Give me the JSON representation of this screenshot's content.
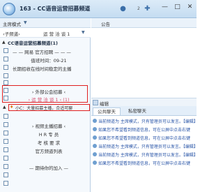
{
  "window": {
    "title": "163 - CC语音运营招募频道",
    "count": "2",
    "controls": {
      "minimize": "—",
      "maximize": "□",
      "close": "✕"
    }
  },
  "left": {
    "mode_label": "主席模式",
    "mode_arrow": "▼",
    "search_left": "‹子频道›",
    "search_right": "运 营 洽 谈 1",
    "search_arrow": "▼",
    "channel_arrow": "▲",
    "channel_name": "CC语音运营招募频道(1)",
    "rows": [
      {
        "text": "— — 网易 官方招聘 — — —",
        "center": false
      },
      {
        "text": "值班时间：09-21",
        "center": false
      },
      {
        "text": "长期招收在线时间稳定的主播",
        "center": false
      },
      {
        "text": "",
        "center": false
      },
      {
        "text": "",
        "center": false
      },
      {
        "text": "",
        "center": false
      },
      {
        "text": "› 外部公会招募 ‹",
        "center": true
      },
      {
        "text": "› 运 营 洽 谈 1 ‹ (1)",
        "center": true,
        "pink": true
      },
      {
        "text": "",
        "center": false
      },
      {
        "text": "› 视频主播招募 ‹",
        "center": true
      },
      {
        "text": "H R 专 员",
        "center": true
      },
      {
        "text": "考 核 要 求",
        "center": true
      },
      {
        "text": "官方频道列表",
        "center": true
      },
      {
        "text": "",
        "center": false
      },
      {
        "text": "— 期待你的加入 —",
        "center": true
      }
    ],
    "user_row": {
      "arrow": "▲",
      "icon": "♦",
      "text": "小C：大量招募主播，合适可聊"
    }
  },
  "right": {
    "announce_label": "公告",
    "edit_label": "编辑",
    "chat_tabs": [
      "公共聊天",
      "私密聊天"
    ],
    "messages": [
      "当前频道为 主席模式，只有管理员可以发言。【编辑】",
      "如果您不希望看到频道信息，可在公屏中点击右键",
      "如果您不希望看到频道信息，可在公屏中点击右键",
      "当前频道为 主席模式，只有管理员可以发言。【编辑】",
      "当前频道为 主席模式，只有管理员可以发言。【编辑】",
      "如果您不希望看到频道信息，可在公屏中点击右键"
    ]
  },
  "colors": {
    "accent": "#2a56a8",
    "highlight_border": "#e02020",
    "pink_text": "#d24b6b"
  },
  "icons": [
    "app-logo-icon",
    "user-icon",
    "person-add-icon",
    "minimize-icon",
    "maximize-icon",
    "close-icon",
    "square-icon",
    "edit-icon"
  ]
}
